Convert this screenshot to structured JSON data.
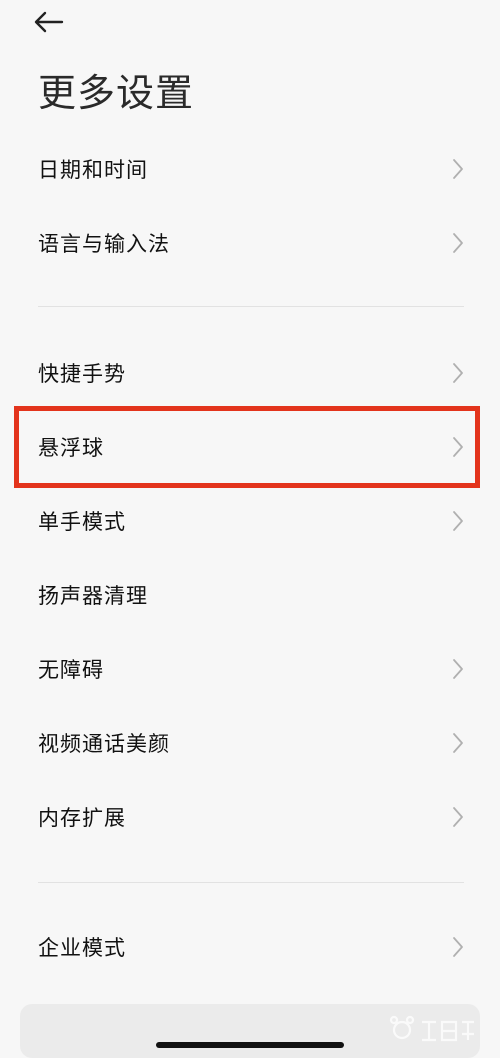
{
  "header": {
    "back_icon": "arrow-left-icon",
    "title": "更多设置"
  },
  "settings": {
    "group1": [
      {
        "label": "日期和时间"
      },
      {
        "label": "语言与输入法"
      }
    ],
    "group2": [
      {
        "label": "快捷手势"
      },
      {
        "label": "悬浮球",
        "highlighted": true
      },
      {
        "label": "单手模式"
      },
      {
        "label": "扬声器清理"
      },
      {
        "label": "无障碍"
      },
      {
        "label": "视频通话美颜"
      },
      {
        "label": "内存扩展"
      }
    ],
    "group3": [
      {
        "label": "企业模式"
      }
    ]
  },
  "colors": {
    "background": "#f7f7f7",
    "highlight": "#e3341c",
    "chevron": "#b0b0b0"
  },
  "watermark": {
    "logo": "baidu-jingyan-logo"
  }
}
